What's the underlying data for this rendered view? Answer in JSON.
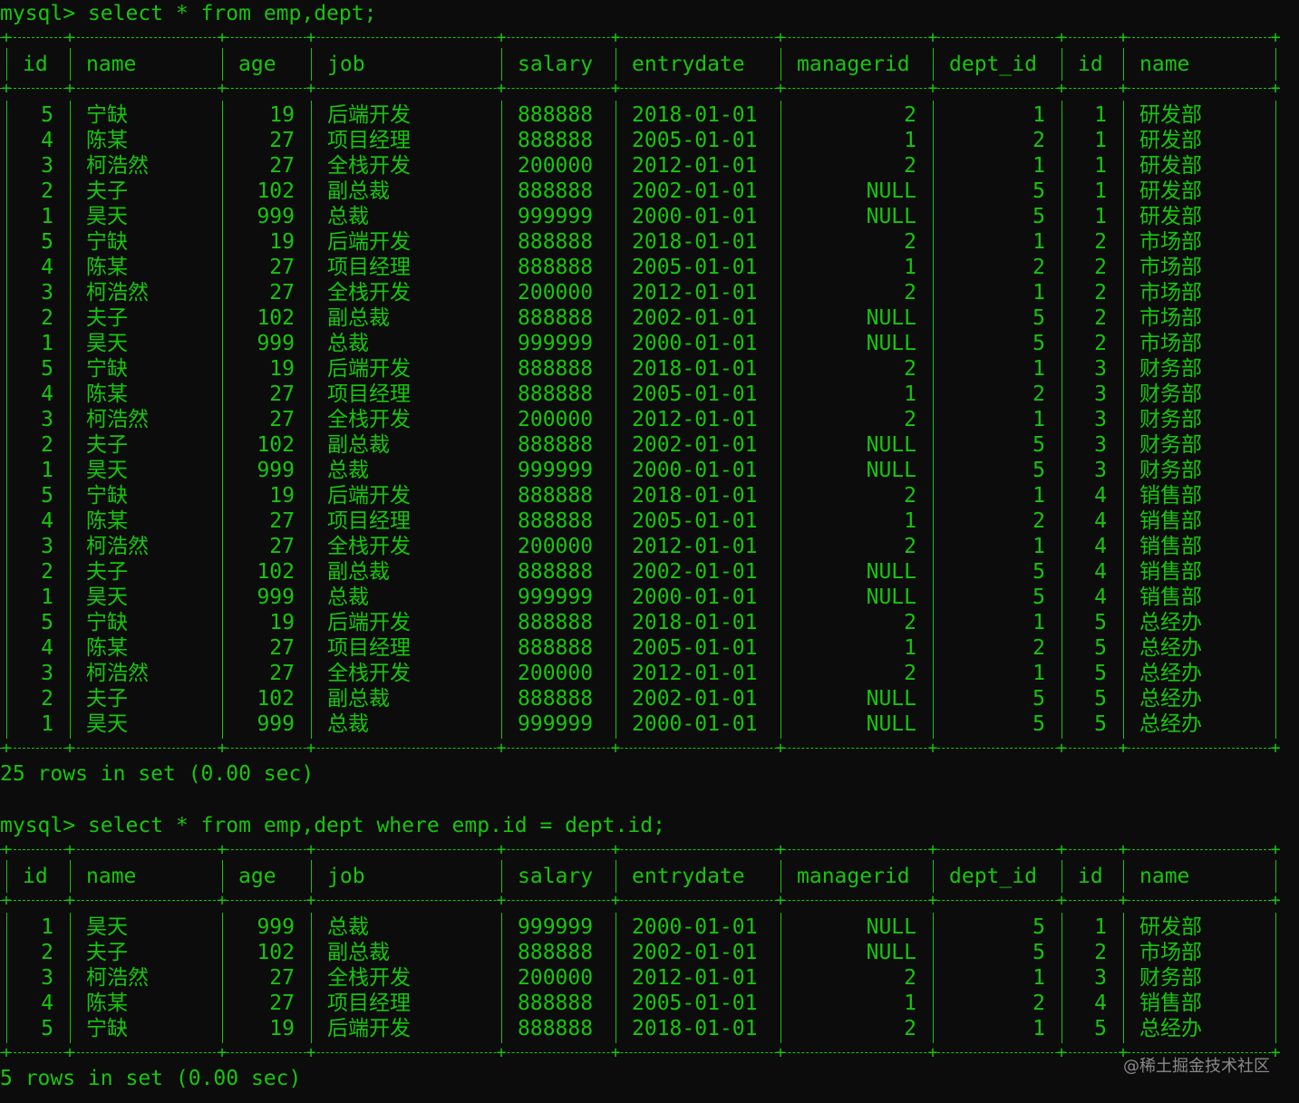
{
  "queries": [
    {
      "prompt": "mysql>",
      "command": "select * from emp,dept;",
      "columns": [
        "id",
        "name",
        "age",
        "job",
        "salary",
        "entrydate",
        "managerid",
        "dept_id",
        "id",
        "name"
      ],
      "rows": [
        [
          "5",
          "宁缺",
          "19",
          "后端开发",
          "888888",
          "2018-01-01",
          "2",
          "1",
          "1",
          "研发部"
        ],
        [
          "4",
          "陈某",
          "27",
          "项目经理",
          "888888",
          "2005-01-01",
          "1",
          "2",
          "1",
          "研发部"
        ],
        [
          "3",
          "柯浩然",
          "27",
          "全栈开发",
          "200000",
          "2012-01-01",
          "2",
          "1",
          "1",
          "研发部"
        ],
        [
          "2",
          "夫子",
          "102",
          "副总裁",
          "888888",
          "2002-01-01",
          "NULL",
          "5",
          "1",
          "研发部"
        ],
        [
          "1",
          "昊天",
          "999",
          "总裁",
          "999999",
          "2000-01-01",
          "NULL",
          "5",
          "1",
          "研发部"
        ],
        [
          "5",
          "宁缺",
          "19",
          "后端开发",
          "888888",
          "2018-01-01",
          "2",
          "1",
          "2",
          "市场部"
        ],
        [
          "4",
          "陈某",
          "27",
          "项目经理",
          "888888",
          "2005-01-01",
          "1",
          "2",
          "2",
          "市场部"
        ],
        [
          "3",
          "柯浩然",
          "27",
          "全栈开发",
          "200000",
          "2012-01-01",
          "2",
          "1",
          "2",
          "市场部"
        ],
        [
          "2",
          "夫子",
          "102",
          "副总裁",
          "888888",
          "2002-01-01",
          "NULL",
          "5",
          "2",
          "市场部"
        ],
        [
          "1",
          "昊天",
          "999",
          "总裁",
          "999999",
          "2000-01-01",
          "NULL",
          "5",
          "2",
          "市场部"
        ],
        [
          "5",
          "宁缺",
          "19",
          "后端开发",
          "888888",
          "2018-01-01",
          "2",
          "1",
          "3",
          "财务部"
        ],
        [
          "4",
          "陈某",
          "27",
          "项目经理",
          "888888",
          "2005-01-01",
          "1",
          "2",
          "3",
          "财务部"
        ],
        [
          "3",
          "柯浩然",
          "27",
          "全栈开发",
          "200000",
          "2012-01-01",
          "2",
          "1",
          "3",
          "财务部"
        ],
        [
          "2",
          "夫子",
          "102",
          "副总裁",
          "888888",
          "2002-01-01",
          "NULL",
          "5",
          "3",
          "财务部"
        ],
        [
          "1",
          "昊天",
          "999",
          "总裁",
          "999999",
          "2000-01-01",
          "NULL",
          "5",
          "3",
          "财务部"
        ],
        [
          "5",
          "宁缺",
          "19",
          "后端开发",
          "888888",
          "2018-01-01",
          "2",
          "1",
          "4",
          "销售部"
        ],
        [
          "4",
          "陈某",
          "27",
          "项目经理",
          "888888",
          "2005-01-01",
          "1",
          "2",
          "4",
          "销售部"
        ],
        [
          "3",
          "柯浩然",
          "27",
          "全栈开发",
          "200000",
          "2012-01-01",
          "2",
          "1",
          "4",
          "销售部"
        ],
        [
          "2",
          "夫子",
          "102",
          "副总裁",
          "888888",
          "2002-01-01",
          "NULL",
          "5",
          "4",
          "销售部"
        ],
        [
          "1",
          "昊天",
          "999",
          "总裁",
          "999999",
          "2000-01-01",
          "NULL",
          "5",
          "4",
          "销售部"
        ],
        [
          "5",
          "宁缺",
          "19",
          "后端开发",
          "888888",
          "2018-01-01",
          "2",
          "1",
          "5",
          "总经办"
        ],
        [
          "4",
          "陈某",
          "27",
          "项目经理",
          "888888",
          "2005-01-01",
          "1",
          "2",
          "5",
          "总经办"
        ],
        [
          "3",
          "柯浩然",
          "27",
          "全栈开发",
          "200000",
          "2012-01-01",
          "2",
          "1",
          "5",
          "总经办"
        ],
        [
          "2",
          "夫子",
          "102",
          "副总裁",
          "888888",
          "2002-01-01",
          "NULL",
          "5",
          "5",
          "总经办"
        ],
        [
          "1",
          "昊天",
          "999",
          "总裁",
          "999999",
          "2000-01-01",
          "NULL",
          "5",
          "5",
          "总经办"
        ]
      ],
      "result": "25 rows in set (0.00 sec)"
    },
    {
      "prompt": "mysql>",
      "command": "select * from emp,dept where emp.id = dept.id;",
      "columns": [
        "id",
        "name",
        "age",
        "job",
        "salary",
        "entrydate",
        "managerid",
        "dept_id",
        "id",
        "name"
      ],
      "rows": [
        [
          "1",
          "昊天",
          "999",
          "总裁",
          "999999",
          "2000-01-01",
          "NULL",
          "5",
          "1",
          "研发部"
        ],
        [
          "2",
          "夫子",
          "102",
          "副总裁",
          "888888",
          "2002-01-01",
          "NULL",
          "5",
          "2",
          "市场部"
        ],
        [
          "3",
          "柯浩然",
          "27",
          "全栈开发",
          "200000",
          "2012-01-01",
          "2",
          "1",
          "3",
          "财务部"
        ],
        [
          "4",
          "陈某",
          "27",
          "项目经理",
          "888888",
          "2005-01-01",
          "1",
          "2",
          "4",
          "销售部"
        ],
        [
          "5",
          "宁缺",
          "19",
          "后端开发",
          "888888",
          "2018-01-01",
          "2",
          "1",
          "5",
          "总经办"
        ]
      ],
      "result": "5 rows in set (0.00 sec)"
    }
  ],
  "watermark": "@稀土掘金技术社区",
  "colors": {
    "background": "#0c0c0c",
    "text": "#16c60c",
    "watermark": "#8a8a8a"
  }
}
